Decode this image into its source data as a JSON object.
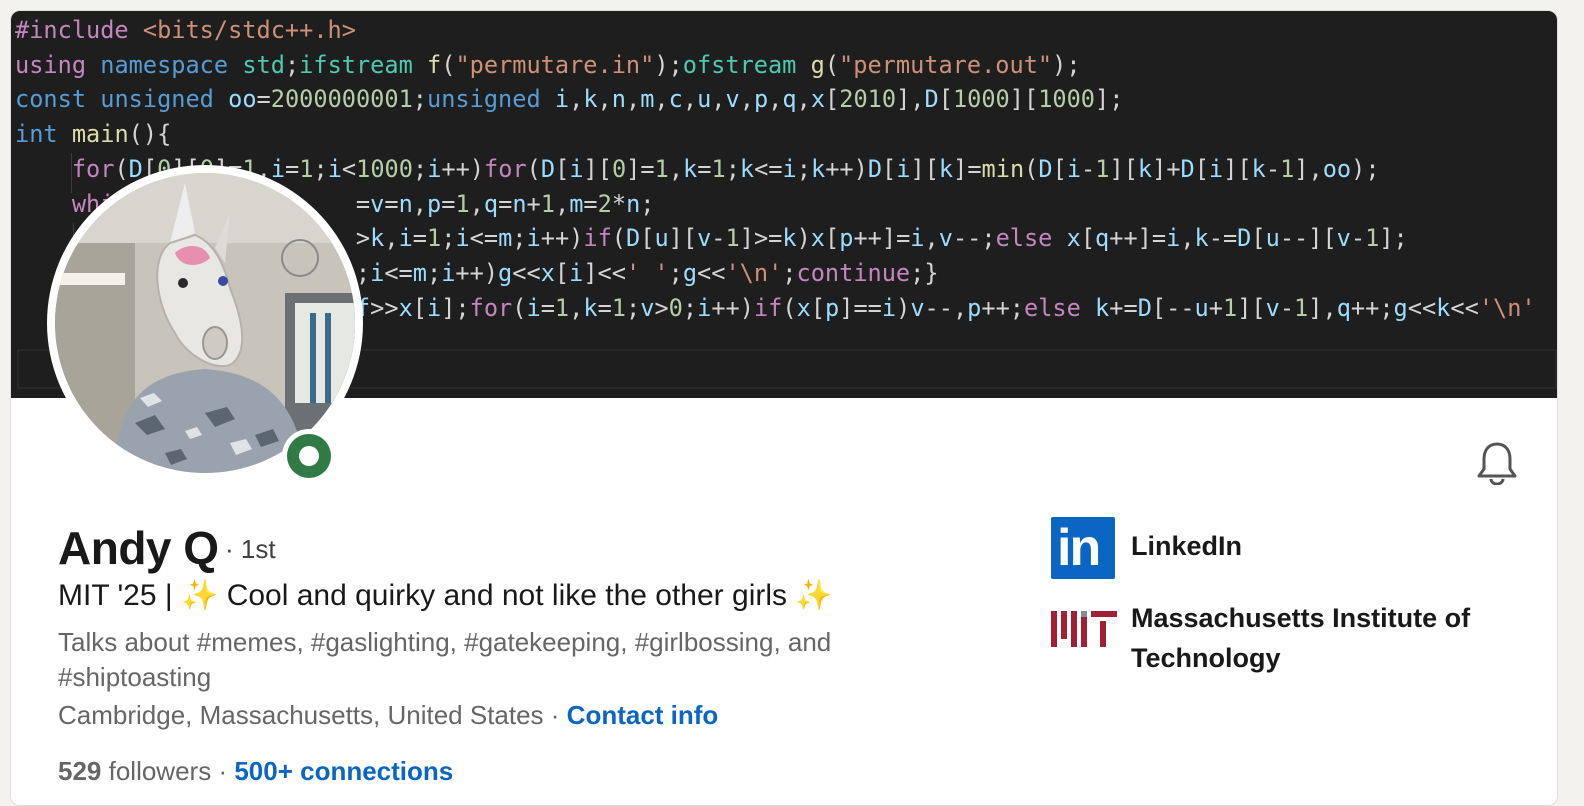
{
  "profile": {
    "name": "Andy Q",
    "degree": "· 1st",
    "headline": "MIT '25 | ✨ Cool and quirky and not like the other girls ✨",
    "talks_about": "Talks about #memes, #gaslighting, #gatekeeping, #girlbossing, and #shiptoasting",
    "location": "Cambridge, Massachusetts, United States",
    "separator": " · ",
    "contact_info": "Contact info",
    "followers_count": "529",
    "followers_label": " followers",
    "connections": "500+ connections",
    "status_color": "#2f7a45"
  },
  "companies": [
    {
      "name": "LinkedIn",
      "logo": "linkedin-logo",
      "logo_text": "in"
    },
    {
      "name": "Massachusetts Institute of Technology",
      "logo": "mit-logo"
    }
  ],
  "banner_code": [
    "#include <bits/stdc++.h>",
    "using namespace std;ifstream f(\"permutare.in\");ofstream g(\"permutare.out\");",
    "const unsigned oo=2000000001;unsigned i,k,n,m,c,u,v,p,q,x[2010],D[1000][1000];",
    "int main(){",
    "    for(D[0][0]=1,i=1;i<1000;i++)for(D[i][0]=1,k=1;k<=i;k++)D[i][k]=min(D[i-1][k]+D[i][k-1],oo);",
    "    whil                =v=n,p=1,q=n+1,m=2*n;",
    "                        >k,i=1;i<=m;i++)if(D[u][v-1]>=k)x[p++]=i,v--;else x[q++]=i,k-=D[u--][v-1];",
    "                        ;i<=m;i++)g<<x[i]<<' ';g<<'\\n';continue;}",
    "                        f>>x[i];for(i=1,k=1;v>0;i++)if(x[p]==i)v--,p++;else k+=D[--u+1][v-1],q++;g<<k<<'\\n'"
  ]
}
